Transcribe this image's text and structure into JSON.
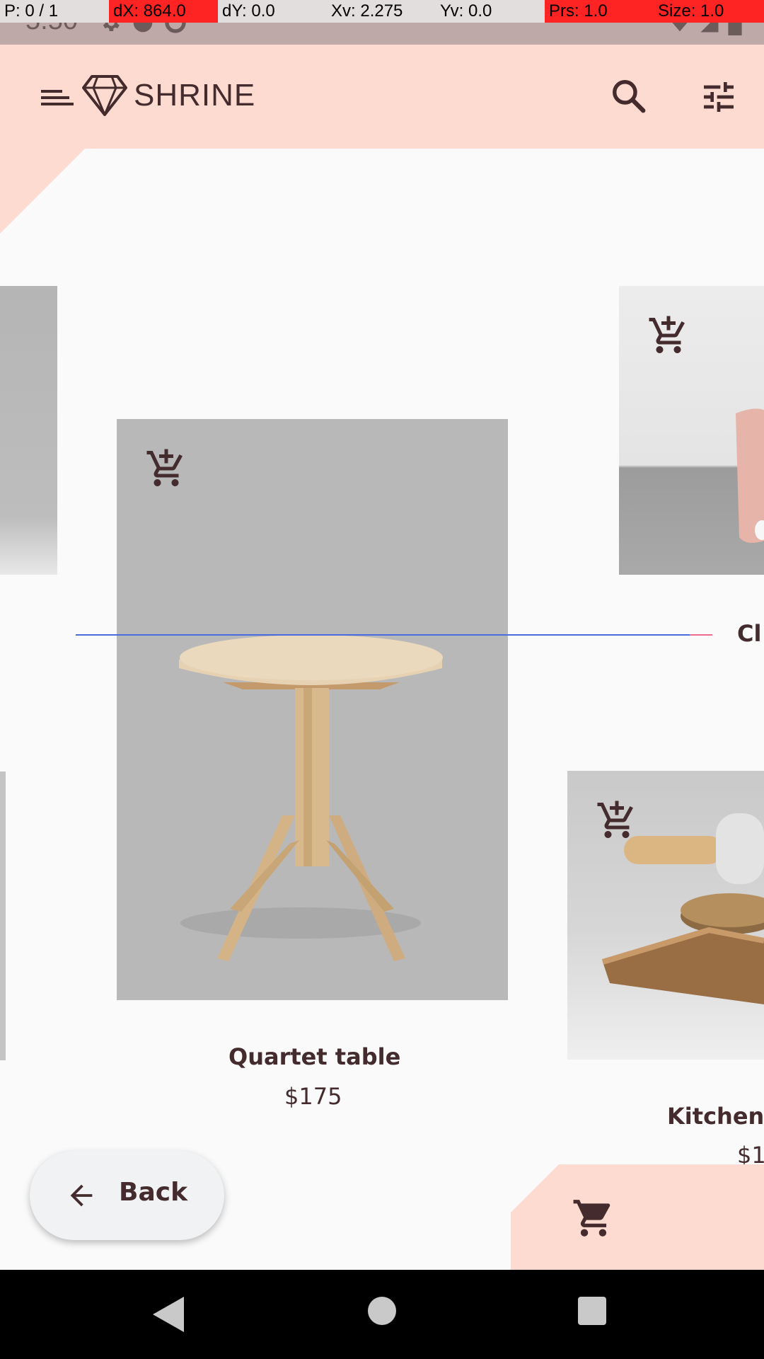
{
  "debug": {
    "pointers": "P: 0 / 1",
    "dx": "dX: 864.0",
    "dy": "dY: 0.0",
    "xv": "Xv: 2.275",
    "yv": "Yv: 0.0",
    "prs": "Prs: 1.0",
    "size": "Size: 1.0"
  },
  "status_bar": {
    "time": "5:50"
  },
  "app_bar": {
    "title": "SHRINE",
    "menu_icon": "menu-icon",
    "logo_icon": "diamond-logo-icon",
    "search_icon": "search-icon",
    "filter_icon": "tune-icon"
  },
  "products": {
    "center": {
      "name": "Quartet table",
      "price": "$175"
    },
    "right_top": {
      "name_visible": "Cl"
    },
    "right_bottom": {
      "name_visible": "Kitchen",
      "price_visible": "$1"
    }
  },
  "back_button": {
    "label": "Back",
    "icon": "arrow-back-icon"
  },
  "cart": {
    "icon": "shopping-cart-icon"
  },
  "colors": {
    "app_bar_bg": "#fedbd0",
    "text_primary": "#442b2d",
    "page_bg": "#fafafa",
    "fab_bg": "#f0f2f3"
  }
}
